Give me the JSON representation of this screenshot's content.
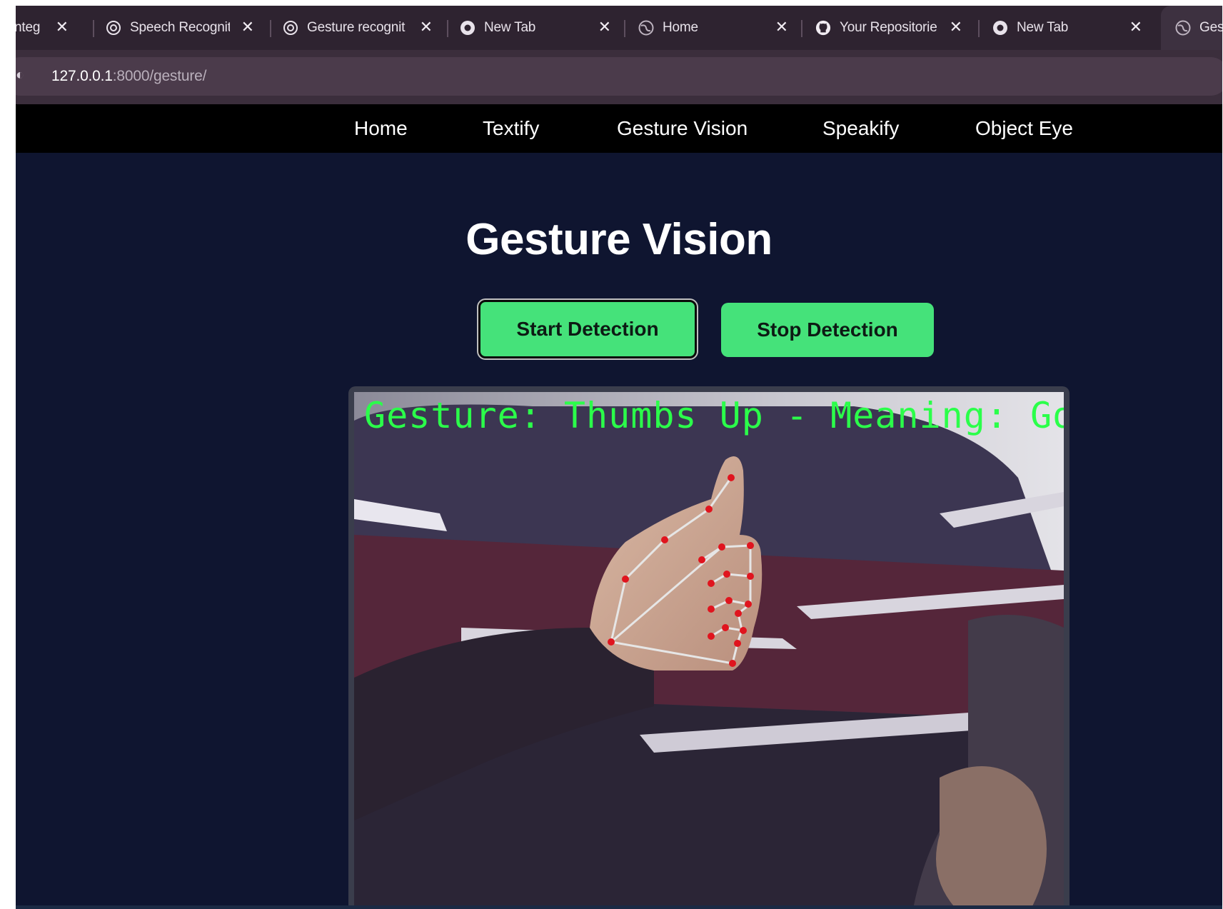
{
  "browser": {
    "tabs": [
      {
        "label": "nteg",
        "icon": "globe-icon"
      },
      {
        "label": "Speech Recognit",
        "icon": "openai-icon"
      },
      {
        "label": "Gesture recognit",
        "icon": "openai-icon"
      },
      {
        "label": "New Tab",
        "icon": "chrome-icon"
      },
      {
        "label": "Home",
        "icon": "globe-icon"
      },
      {
        "label": "Your Repositorie",
        "icon": "github-icon"
      },
      {
        "label": "New Tab",
        "icon": "chrome-icon"
      },
      {
        "label": "Gestur",
        "icon": "globe-icon",
        "active": true
      }
    ],
    "url_host": "127.0.0.1",
    "url_rest": ":8000/gesture/"
  },
  "nav": {
    "items": [
      "Home",
      "Textify",
      "Gesture Vision",
      "Speakify",
      "Object Eye"
    ]
  },
  "page": {
    "title": "Gesture Vision",
    "start_label": "Start Detection",
    "stop_label": "Stop Detection",
    "video_overlay": "Gesture: Thumbs Up - Meaning: Good j"
  },
  "colors": {
    "accent_green": "#45e27a",
    "overlay_green": "#2bff4a",
    "landmark_red": "#e0141e",
    "page_bg": "#0f1530"
  }
}
